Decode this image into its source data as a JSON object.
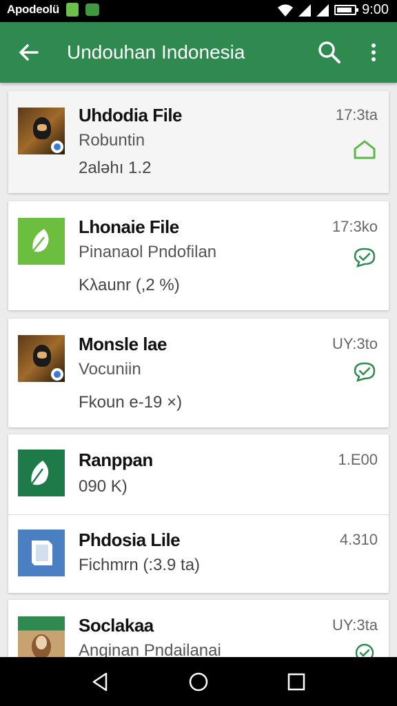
{
  "status_bar": {
    "app_name": "Apodeolü",
    "time": "9:00"
  },
  "app_bar": {
    "title": "Undouhan Indonesia",
    "color": "#2e8a4e"
  },
  "items": [
    {
      "title": "Uhdodia File",
      "subtitle": "Robuntin",
      "detail": "2aləhı 1.2",
      "time": "17:3ta",
      "thumb": "movie-poster",
      "status_icon": "home-icon"
    },
    {
      "title": "Lhonaie File",
      "subtitle": "Pinanaol Pndofilan",
      "detail": "Kλaunr (,2 %)",
      "time": "17:3ko",
      "thumb": "leaf-app-icon",
      "status_icon": "chat-check-icon"
    },
    {
      "title": "Monsle lae",
      "subtitle": "Vocuniin",
      "detail": "Fkoun e-19 ×)",
      "time": "UY:3to",
      "thumb": "movie-poster",
      "status_icon": "chat-check-icon"
    },
    {
      "title": "Ranppan",
      "subtitle": "",
      "detail": "090 K)",
      "time": "1.E00",
      "thumb": "leaf-app-icon",
      "status_icon": ""
    },
    {
      "title": "Phdosia Lile",
      "subtitle": "",
      "detail": "Fichmrn (:3.9 ta)",
      "time": "4.310",
      "thumb": "document-icon",
      "status_icon": ""
    },
    {
      "title": "Soclakaa",
      "subtitle": "Anginan Pndailanai",
      "detail": "",
      "time": "UY:3ta",
      "thumb": "book-cover",
      "status_icon": "check-circle-icon"
    }
  ]
}
